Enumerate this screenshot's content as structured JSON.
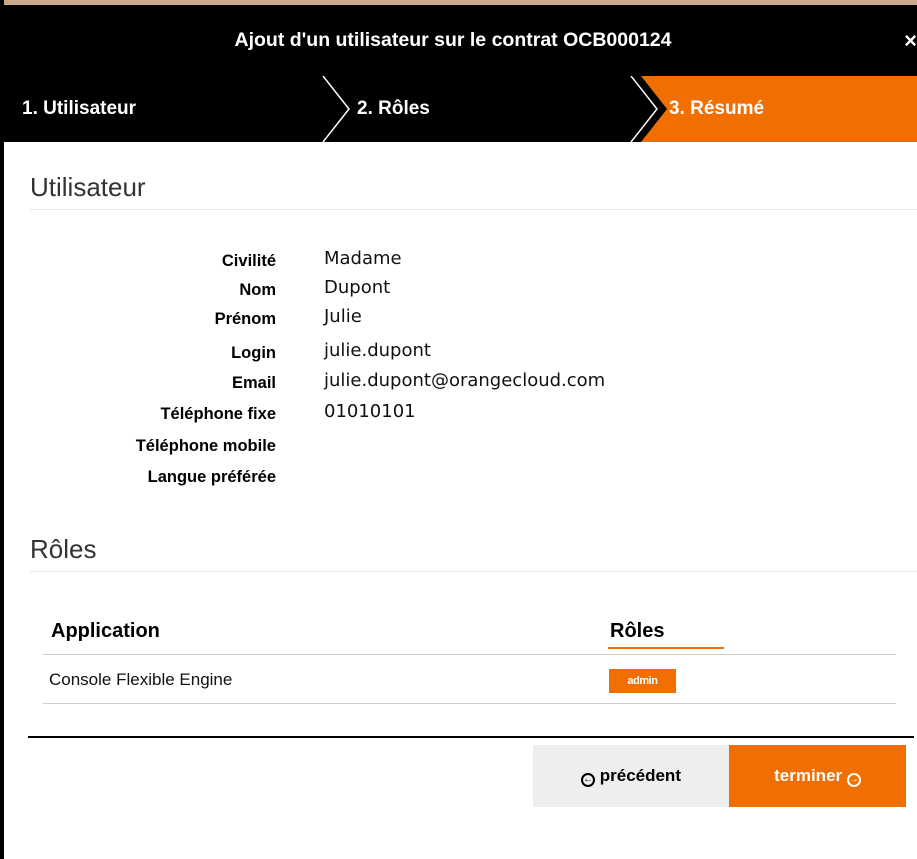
{
  "dialog": {
    "title": "Ajout d'un utilisateur sur le contrat OCB000124",
    "close_icon": "×"
  },
  "steps": [
    {
      "label": "1. Utilisateur",
      "active": false
    },
    {
      "label": "2. Rôles",
      "active": false
    },
    {
      "label": "3. Résumé",
      "active": true
    }
  ],
  "colors": {
    "accent": "#f16e00",
    "bar": "#000000"
  },
  "user_section": {
    "title": "Utilisateur",
    "fields": [
      {
        "label": "Civilité",
        "value": "Madame"
      },
      {
        "label": "Nom",
        "value": "Dupont"
      },
      {
        "label": "Prénom",
        "value": "Julie"
      },
      {
        "label": "Login",
        "value": "julie.dupont"
      },
      {
        "label": "Email",
        "value": "julie.dupont@orangecloud.com"
      },
      {
        "label": "Téléphone fixe",
        "value": "01010101"
      },
      {
        "label": "Téléphone mobile",
        "value": ""
      },
      {
        "label": "Langue préférée",
        "value": ""
      }
    ]
  },
  "roles_section": {
    "title": "Rôles",
    "columns": [
      "Application",
      "Rôles"
    ],
    "rows": [
      {
        "application": "Console Flexible Engine",
        "role": "admin"
      }
    ]
  },
  "footer": {
    "prev_label": "précédent",
    "next_label": "terminer",
    "prev_icon": "arrow-left-circle-icon",
    "next_icon": "arrow-right-circle-icon"
  }
}
